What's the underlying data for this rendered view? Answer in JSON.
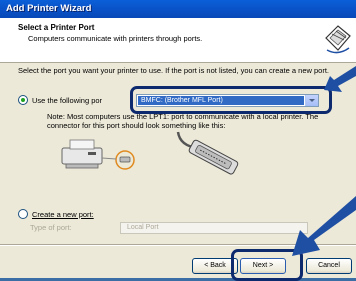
{
  "window": {
    "title": "Add Printer Wizard"
  },
  "header": {
    "title": "Select a Printer Port",
    "subtitle": "Computers communicate with printers through ports."
  },
  "body": {
    "instruction": "Select the port you want your printer to use.  If the port is not listed, you can create a new port."
  },
  "options": {
    "use_existing": {
      "label": "Use the following por",
      "selected": true
    },
    "port_combo": {
      "value": "BMFC: (Brother MFL Port)"
    },
    "note": "Note: Most computers use the LPT1: port to communicate with a local printer. The connector for this port should look something like this:",
    "create_new": {
      "label": "Create a new port:",
      "selected": false
    },
    "type_of_port": {
      "label": "Type of port:",
      "value": "Local Port"
    }
  },
  "buttons": {
    "back": "< Back",
    "next": "Next >",
    "cancel": "Cancel"
  },
  "colors": {
    "title_bar": "#0a5fd8",
    "selection": "#316ac5",
    "highlight_frame": "#0d2a6e",
    "arrow": "#1f4fa3"
  }
}
